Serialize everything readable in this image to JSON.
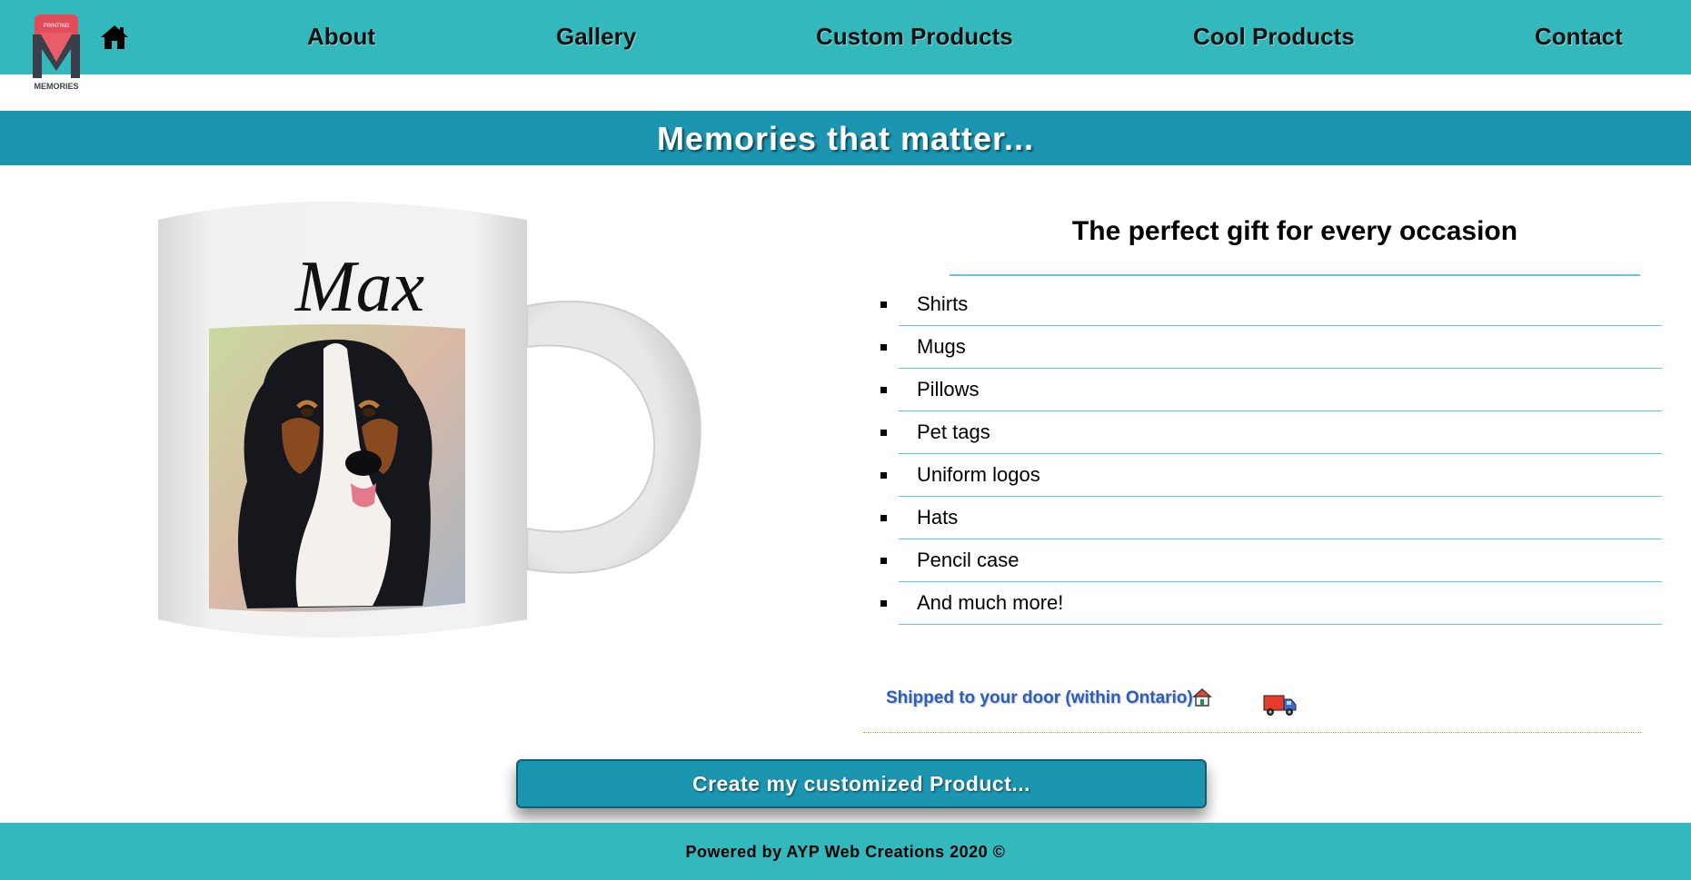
{
  "nav": {
    "logo": {
      "top_text": "PRINTING",
      "letter": "M",
      "bottom_text": "MEMORIES"
    },
    "home_icon": "home-icon",
    "links": [
      "About",
      "Gallery",
      "Custom Products",
      "Cool Products",
      "Contact"
    ]
  },
  "banner": {
    "title": "Memories that matter..."
  },
  "hero": {
    "mug_name": "Max"
  },
  "panel": {
    "heading": "The perfect gift for every occasion",
    "items": [
      "Shirts",
      "Mugs",
      "Pillows",
      "Pet tags",
      "Uniform logos",
      "Hats",
      "Pencil case",
      "And much more!"
    ],
    "shipping": "Shipped to your door (within Ontario)",
    "icons": [
      "house-icon",
      "truck-icon"
    ]
  },
  "cta": {
    "label": "Create my customized Product..."
  },
  "footer": {
    "text": "Powered by AYP Web Creations 2020 ©"
  },
  "colors": {
    "nav_bg": "#33b8bc",
    "banner_bg": "#1b95b0",
    "rule": "#5bc8e6",
    "link_blue": "#2a5fc0"
  }
}
